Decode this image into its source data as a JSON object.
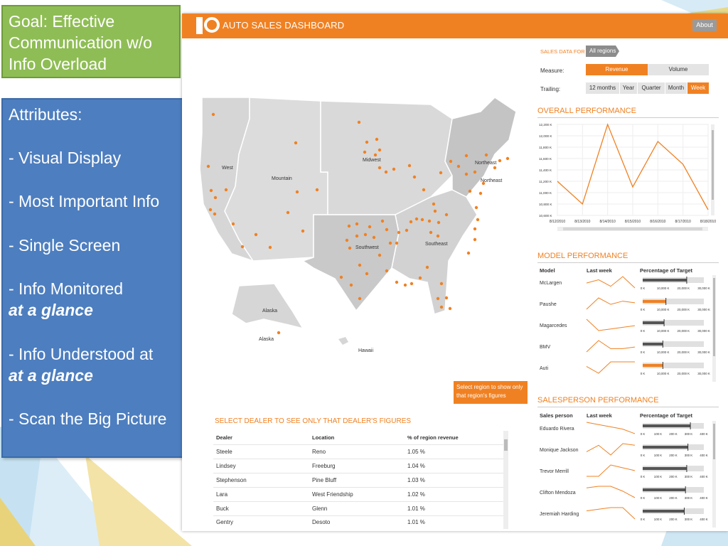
{
  "slide": {
    "goal_text": "Goal:  Effective Communication w/o Info Overload",
    "attributes_heading": "Attributes:",
    "attr1": "- Visual Display",
    "attr2": "- Most Important Info",
    "attr3": "- Single Screen",
    "attr4": "- Info Monitored",
    "attr4_em": "at a glance",
    "attr5": "- Info Understood at",
    "attr5_em": "at a glance",
    "attr6": "- Scan the Big Picture"
  },
  "dashboard": {
    "title": "AUTO SALES DASHBOARD",
    "about_label": "About",
    "sales_data_for_label": "SALES DATA FOR",
    "region_selected": "All regions",
    "measure_label": "Measure:",
    "measure_options": [
      "Revenue",
      "Volume"
    ],
    "measure_active": "Revenue",
    "trailing_label": "Trailing:",
    "trailing_options": [
      "12 months",
      "Year",
      "Quarter",
      "Month",
      "Week"
    ],
    "trailing_active": "Week",
    "colors": {
      "accent": "#f08122",
      "map_land": "#d9d9d9",
      "map_dark": "#c4c4c4"
    }
  },
  "map": {
    "region_labels": [
      "West",
      "Mountain",
      "Midwest",
      "Northeast",
      "Northeast",
      "Southwest",
      "Southeast",
      "Alaska",
      "Alaska",
      "Hawaii"
    ],
    "tip": "Select region to show only that region's figures"
  },
  "dealer_table": {
    "title": "SELECT DEALER TO SEE ONLY THAT DEALER'S FIGURES",
    "columns": [
      "Dealer",
      "Location",
      "% of region revenue"
    ],
    "rows": [
      [
        "Steele",
        "Reno",
        "1.05 %"
      ],
      [
        "Lindsey",
        "Freeburg",
        "1.04 %"
      ],
      [
        "Stephenson",
        "Pine Bluff",
        "1.03 %"
      ],
      [
        "Lara",
        "West Friendship",
        "1.02 %"
      ],
      [
        "Buck",
        "Glenn",
        "1.01 %"
      ],
      [
        "Gentry",
        "Desoto",
        "1.01 %"
      ]
    ]
  },
  "overall_performance": {
    "title": "OVERALL PERFORMANCE"
  },
  "chart_data": {
    "type": "line",
    "title": "",
    "x": [
      "8/12/2010",
      "8/13/2010",
      "8/14/2010",
      "8/15/2010",
      "8/16/2010",
      "8/17/2010",
      "8/18/2010"
    ],
    "series": [
      {
        "values": [
          11200,
          10800,
          12200,
          11100,
          11900,
          11500,
          10700
        ]
      }
    ],
    "y_ticks": [
      "12,200 K",
      "12,000 K",
      "11,800 K",
      "11,600 K",
      "11,400 K",
      "11,200 K",
      "11,000 K",
      "10,800 K",
      "10,600 K"
    ],
    "ylim": [
      10600,
      12200
    ],
    "grid": true
  },
  "model_performance": {
    "title": "MODEL PERFORMANCE",
    "columns": [
      "Model",
      "Last week",
      "Percentage of Target"
    ],
    "axis_labels": [
      "0 K",
      "10,000 K",
      "20,000 K",
      "30,000 K"
    ],
    "rows": [
      {
        "name": "McLargen",
        "value": 0.72,
        "hl": false,
        "spark": [
          6,
          8,
          4,
          10,
          3
        ]
      },
      {
        "name": "Paushe",
        "value": 0.38,
        "hl": true,
        "spark": [
          2,
          9,
          5,
          7,
          6
        ]
      },
      {
        "name": "Magarcedes",
        "value": 0.35,
        "hl": false,
        "spark": [
          10,
          3,
          4,
          5,
          6
        ]
      },
      {
        "name": "BMV",
        "value": 0.33,
        "hl": false,
        "spark": [
          2,
          9,
          4,
          4,
          5
        ]
      },
      {
        "name": "Auti",
        "value": 0.33,
        "hl": true,
        "spark": [
          6,
          3,
          8,
          8,
          8
        ]
      }
    ]
  },
  "salesperson_performance": {
    "title": "SALESPERSON PERFORMANCE",
    "columns": [
      "Sales person",
      "Last week",
      "Percentage of Target"
    ],
    "axis_labels": [
      "0 K",
      "100 K",
      "200 K",
      "300 K",
      "400 K"
    ],
    "rows": [
      {
        "name": "Eduardo Rivera",
        "value": 0.78,
        "spark": [
          9,
          8,
          7,
          6,
          4
        ]
      },
      {
        "name": "Monique Jackson",
        "value": 0.74,
        "spark": [
          5,
          9,
          3,
          10,
          9
        ]
      },
      {
        "name": "Trevor Merrill",
        "value": 0.72,
        "spark": [
          4,
          4,
          8,
          7,
          6
        ]
      },
      {
        "name": "Clifton Mendoza",
        "value": 0.7,
        "spark": [
          9,
          10,
          10,
          7,
          3
        ]
      },
      {
        "name": "Jeremiah Harding",
        "value": 0.68,
        "spark": [
          7,
          8,
          9,
          9,
          2
        ]
      }
    ]
  }
}
